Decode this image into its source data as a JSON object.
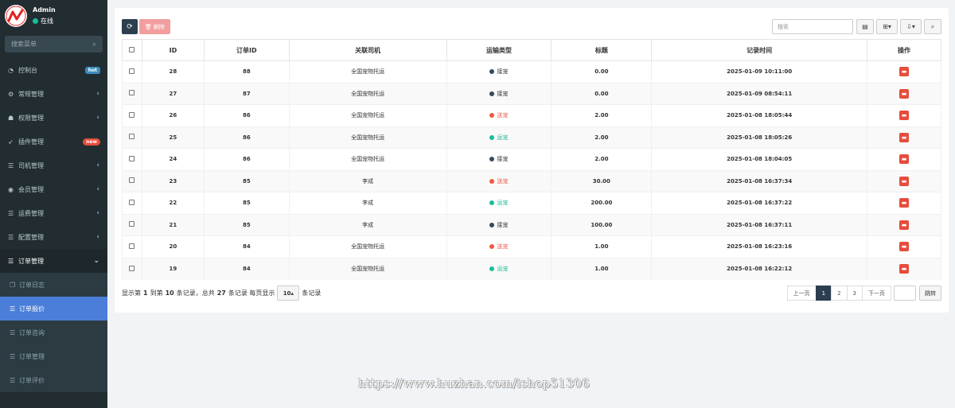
{
  "user": {
    "name": "Admin",
    "status": "在线"
  },
  "sidebar": {
    "search_placeholder": "搜索菜单",
    "items": [
      {
        "label": "控制台",
        "icon": "dashboard-icon",
        "badge": "hot"
      },
      {
        "label": "常规管理",
        "icon": "cogs-icon"
      },
      {
        "label": "权限管理",
        "icon": "group-icon"
      },
      {
        "label": "插件管理",
        "icon": "rocket-icon",
        "badge": "new"
      },
      {
        "label": "司机管理",
        "icon": "list-icon"
      },
      {
        "label": "会员管理",
        "icon": "user-circle-icon"
      },
      {
        "label": "运费管理",
        "icon": "list-icon"
      },
      {
        "label": "配置管理",
        "icon": "list-icon"
      },
      {
        "label": "订单管理",
        "icon": "list-icon"
      }
    ],
    "subitems": [
      {
        "label": "订单日志",
        "icon": "copy-icon"
      },
      {
        "label": "订单报价",
        "icon": "list-icon"
      },
      {
        "label": "订单咨询",
        "icon": "list-icon"
      },
      {
        "label": "订单管理",
        "icon": "list-icon"
      },
      {
        "label": "订单评价",
        "icon": "list-icon"
      }
    ]
  },
  "toolbar": {
    "delete_label": "删除",
    "search_placeholder": "搜索"
  },
  "table": {
    "headers": [
      "ID",
      "订单ID",
      "关联司机",
      "运输类型",
      "标题",
      "记录时间",
      "操作"
    ],
    "rows": [
      {
        "id": "28",
        "order_id": "88",
        "driver": "全国宠物托运",
        "type": "接宠",
        "title": "0.00",
        "time": "2025-01-09 10:11:00"
      },
      {
        "id": "27",
        "order_id": "87",
        "driver": "全国宠物托运",
        "type": "接宠",
        "title": "0.00",
        "time": "2025-01-09 08:54:11"
      },
      {
        "id": "26",
        "order_id": "86",
        "driver": "全国宠物托运",
        "type": "送宠",
        "title": "2.00",
        "time": "2025-01-08 18:05:44"
      },
      {
        "id": "25",
        "order_id": "86",
        "driver": "全国宠物托运",
        "type": "运宠",
        "title": "2.00",
        "time": "2025-01-08 18:05:26"
      },
      {
        "id": "24",
        "order_id": "86",
        "driver": "全国宠物托运",
        "type": "接宠",
        "title": "2.00",
        "time": "2025-01-08 18:04:05"
      },
      {
        "id": "23",
        "order_id": "85",
        "driver": "李成",
        "type": "送宠",
        "title": "30.00",
        "time": "2025-01-08 16:37:34"
      },
      {
        "id": "22",
        "order_id": "85",
        "driver": "李成",
        "type": "运宠",
        "title": "200.00",
        "time": "2025-01-08 16:37:22"
      },
      {
        "id": "21",
        "order_id": "85",
        "driver": "李成",
        "type": "接宠",
        "title": "100.00",
        "time": "2025-01-08 16:37:11"
      },
      {
        "id": "20",
        "order_id": "84",
        "driver": "全国宠物托运",
        "type": "送宠",
        "title": "1.00",
        "time": "2025-01-08 16:23:16"
      },
      {
        "id": "19",
        "order_id": "84",
        "driver": "全国宠物托运",
        "type": "运宠",
        "title": "1.00",
        "time": "2025-01-08 16:22:12"
      }
    ]
  },
  "type_colors": {
    "接宠": "#34495e",
    "送宠": "#f75444",
    "运宠": "#18bc9c"
  },
  "type_text_colors": {
    "接宠": "#333333",
    "送宠": "#f75444",
    "运宠": "#18bc9c"
  },
  "footer": {
    "p1": "显示第",
    "from": "1",
    "p2": "到第",
    "to": "10",
    "p3": "条记录，总共",
    "total": "27",
    "p4": "条记录 每页显示",
    "page_size": "10",
    "p5": "条记录"
  },
  "pager": {
    "prev": "上一页",
    "pages": [
      "1",
      "2",
      "3"
    ],
    "next": "下一页",
    "jump": "跳转"
  },
  "watermark": "https://www.huzhan.com/ishop51306"
}
